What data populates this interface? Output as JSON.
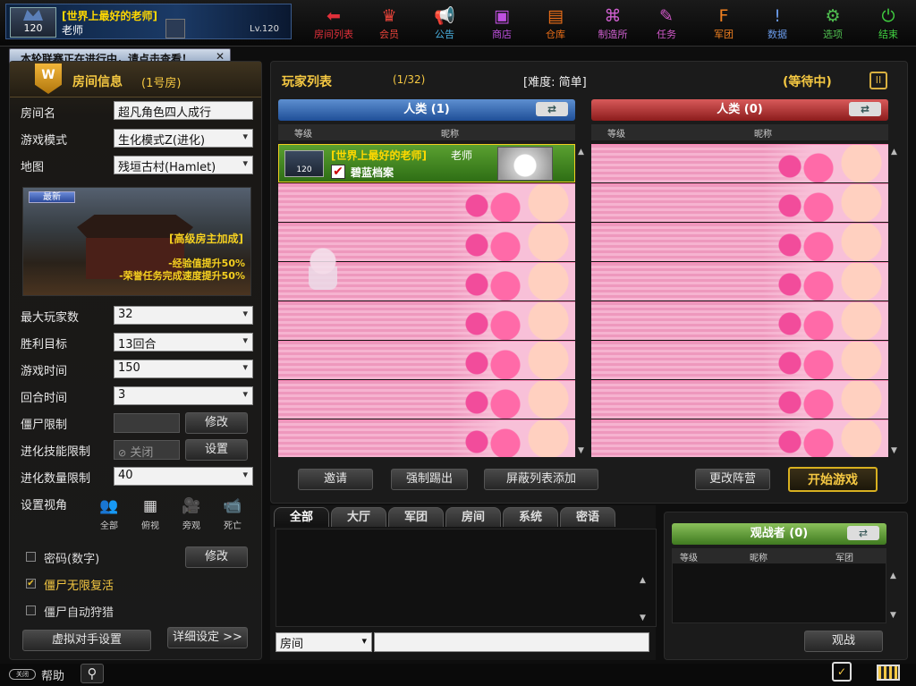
{
  "profile": {
    "title": "[世界上最好的老师]",
    "name": "老师",
    "level": "Lv.120",
    "badge_level": "120"
  },
  "notice": {
    "text": "本轮联赛正在进行中，请点击查看！",
    "close": "✕"
  },
  "nav": [
    {
      "label": "房间列表",
      "icon": "⬅",
      "color": "#e0303a",
      "name": "nav-room-list"
    },
    {
      "label": "会员",
      "icon": "♛",
      "color": "#e8443a",
      "name": "nav-vip"
    },
    {
      "label": "公告",
      "icon": "📢",
      "color": "#4ab0e0",
      "name": "nav-announce"
    },
    {
      "label": "商店",
      "icon": "▣",
      "color": "#c050e0",
      "name": "nav-shop"
    },
    {
      "label": "仓库",
      "icon": "▤",
      "color": "#f07018",
      "name": "nav-storage"
    },
    {
      "label": "制造所",
      "icon": "⌘",
      "color": "#d060d0",
      "name": "nav-craft"
    },
    {
      "label": "任务",
      "icon": "✎",
      "color": "#d058c8",
      "name": "nav-mission"
    },
    {
      "label": "军团",
      "icon": "F",
      "color": "#f08020",
      "name": "nav-clan"
    },
    {
      "label": "数据",
      "icon": "!",
      "color": "#6a9ae8",
      "name": "nav-data"
    },
    {
      "label": "选项",
      "icon": "⚙",
      "color": "#50c050",
      "name": "nav-options"
    },
    {
      "label": "结束",
      "icon": "⏻",
      "color": "#40d040",
      "name": "nav-exit"
    }
  ],
  "room": {
    "header_title": "房间信息",
    "header_number": "(1号房)",
    "emblem": "W",
    "name_label": "房间名",
    "name_value": "超凡角色四人成行",
    "mode_label": "游戏模式",
    "mode_value": "生化模式Z(进化)",
    "map_label": "地图",
    "map_value": "残垣古村(Hamlet)",
    "map_new": "最新",
    "map_bonus_title": "[高级房主加成]",
    "map_bonus_exp": "-经验值提升50%",
    "map_bonus_honor": "-荣誉任务完成速度提升50%",
    "max_players_label": "最大玩家数",
    "max_players_value": "32",
    "win_label": "胜利目标",
    "win_value": "13回合",
    "time_label": "游戏时间",
    "time_value": "150",
    "round_label": "回合时间",
    "round_value": "3",
    "zombie_limit_label": "僵尸限制",
    "zombie_limit_btn": "修改",
    "evo_skill_label": "进化技能限制",
    "evo_skill_value": "关闭",
    "evo_skill_btn": "设置",
    "evo_count_label": "进化数量限制",
    "evo_count_value": "40",
    "view_label": "设置视角",
    "views": [
      {
        "label": "全部",
        "icon": "👥",
        "name": "view-all-icon"
      },
      {
        "label": "俯视",
        "icon": "▦",
        "name": "view-top-icon"
      },
      {
        "label": "旁观",
        "icon": "🎥",
        "name": "view-observe-icon"
      },
      {
        "label": "死亡",
        "icon": "📹",
        "name": "view-dead-icon"
      }
    ],
    "password_label": "密码(数字)",
    "password_btn": "修改",
    "zombie_respawn_label": "僵尸无限复活",
    "zombie_respawn_checked": "✔",
    "zombie_hunt_label": "僵尸自动狩猎",
    "bot_btn": "虚拟对手设置",
    "detail_btn": "详细设定 >>"
  },
  "players": {
    "title": "玩家列表",
    "count": "(1/32)",
    "difficulty": "[难度: 简单]",
    "status": "(等待中)",
    "pause_icon": "II",
    "team_human": "人类 (1)",
    "team_zombie": "人类 (0)",
    "col_level": "等级",
    "col_nick": "昵称",
    "swap": "⇄",
    "player1": {
      "title": "[世界上最好的老师]",
      "name": "老师",
      "level": "120",
      "guild": "碧蓝档案",
      "check": "✔"
    },
    "buttons": {
      "invite": "邀请",
      "kick": "强制踢出",
      "block": "屏蔽列表添加",
      "team": "更改阵营",
      "start": "开始游戏"
    }
  },
  "chat": {
    "tabs": [
      "全部",
      "大厅",
      "军团",
      "房间",
      "系统",
      "密语"
    ],
    "scope": "房间"
  },
  "spectators": {
    "header": "观战者 (0)",
    "swap": "⇄",
    "col_level": "等级",
    "col_nick": "昵称",
    "col_clan": "军团",
    "button": "观战"
  },
  "bottom": {
    "help": "帮助",
    "toggle": "关闭"
  }
}
